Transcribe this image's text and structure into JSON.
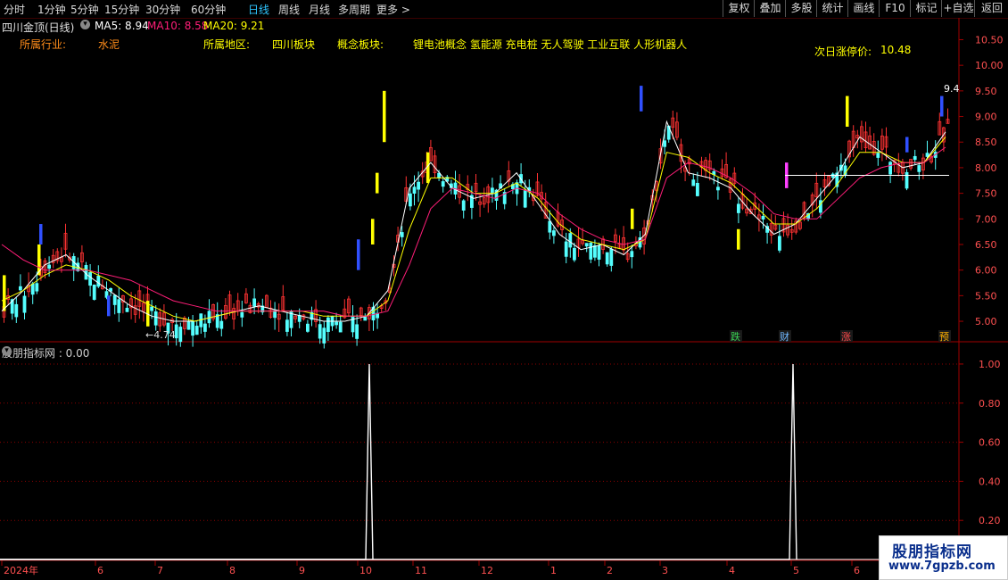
{
  "toolbar": {
    "periods": [
      "分时",
      "1分钟",
      "5分钟",
      "15分钟",
      "30分钟",
      "60分钟",
      "日线",
      "周线",
      "月线",
      "多周期",
      "更多 >"
    ],
    "active_period": "日线",
    "right_buttons": [
      "复权",
      "叠加",
      "多股",
      "统计",
      "画线",
      "F10",
      "标记",
      "+自选",
      "返回"
    ]
  },
  "stock": {
    "title": "四川金顶(日线)",
    "ma5_label": "MA5: 8.94",
    "ma10_label": "MA10: 8.58",
    "ma20_label": "MA20: 9.21"
  },
  "info": {
    "industry_label": "所属行业:",
    "industry_value": "水泥",
    "region_label": "所属地区:",
    "region_value": "四川板块",
    "concept_label": "概念板块:",
    "concept_value": "锂电池概念 氢能源 充电桩 无人驾驶 工业互联 人形机器人",
    "limit_label": "次日涨停价:",
    "limit_value": "10.48"
  },
  "annotations": {
    "low_price": "4.74",
    "high_price": "9.4",
    "markers": [
      {
        "text": "跌",
        "color": "#39d353"
      },
      {
        "text": "财",
        "color": "#6fb7ff"
      },
      {
        "text": "涨",
        "color": "#ff4a4a"
      },
      {
        "text": "预",
        "color": "#ffb000"
      }
    ]
  },
  "colors": {
    "up": "#ff3232",
    "down": "#54ffff",
    "ma5": "#ffffff",
    "ma10": "#ffff00",
    "ma20": "#ff1e78",
    "grid_red": "#8c0000",
    "axis_label": "#ff5050",
    "panel_border": "#a00000"
  },
  "indicator": {
    "title": "股朋指标网 : 0.00"
  },
  "chart_data": [
    {
      "type": "candlestick",
      "title": "四川金顶(日线)",
      "y_ticks": [
        "10.50",
        "10.00",
        "9.50",
        "9.00",
        "8.50",
        "8.00",
        "7.50",
        "7.00",
        "6.50",
        "6.00",
        "5.50",
        "5.00"
      ],
      "ylim": [
        4.6,
        10.7
      ],
      "x_ticks": [
        "2024年",
        "6",
        "7",
        "8",
        "9",
        "10",
        "11",
        "12",
        "1",
        "2",
        "3",
        "4",
        "5",
        "6"
      ],
      "series": [
        {
          "name": "MA5",
          "values": [
            5.2,
            5.6,
            6.1,
            6.3,
            5.9,
            5.6,
            5.3,
            5.1,
            5.0,
            5.0,
            5.1,
            5.2,
            5.3,
            5.2,
            5.1,
            5.0,
            5.0,
            5.1,
            5.6,
            7.6,
            8.1,
            7.6,
            7.4,
            7.5,
            7.9,
            7.3,
            6.7,
            6.4,
            6.5,
            6.3,
            6.7,
            8.9,
            7.9,
            7.8,
            7.6,
            7.1,
            6.7,
            6.9,
            7.4,
            7.9,
            8.6,
            8.3,
            8.0,
            8.1,
            8.7
          ]
        },
        {
          "name": "MA10",
          "values": [
            5.4,
            5.6,
            5.9,
            6.1,
            6.0,
            5.8,
            5.5,
            5.3,
            5.1,
            5.0,
            5.1,
            5.2,
            5.2,
            5.2,
            5.2,
            5.1,
            5.1,
            5.1,
            5.4,
            6.8,
            7.8,
            7.8,
            7.5,
            7.5,
            7.7,
            7.4,
            6.9,
            6.6,
            6.5,
            6.4,
            6.6,
            8.3,
            8.2,
            7.9,
            7.7,
            7.3,
            6.9,
            6.9,
            7.2,
            7.7,
            8.3,
            8.3,
            8.1,
            8.1,
            8.6
          ]
        },
        {
          "name": "MA20",
          "values": [
            6.5,
            6.2,
            6.0,
            6.0,
            6.0,
            5.9,
            5.8,
            5.6,
            5.4,
            5.3,
            5.2,
            5.2,
            5.2,
            5.2,
            5.2,
            5.2,
            5.1,
            5.1,
            5.2,
            6.1,
            7.2,
            7.6,
            7.5,
            7.4,
            7.6,
            7.5,
            7.1,
            6.8,
            6.6,
            6.5,
            6.6,
            7.8,
            8.1,
            8.0,
            7.8,
            7.5,
            7.1,
            7.0,
            7.0,
            7.4,
            7.8,
            8.0,
            8.1,
            8.1,
            8.4
          ]
        }
      ]
    },
    {
      "type": "line",
      "title": "股朋指标网",
      "y_ticks": [
        "1.00",
        "0.80",
        "0.60",
        "0.40",
        "0.20"
      ],
      "ylim": [
        0,
        1.05
      ],
      "signals": [
        {
          "x_tick": "10",
          "value": 1.0
        },
        {
          "x_tick": "5",
          "value": 1.0
        }
      ]
    }
  ]
}
